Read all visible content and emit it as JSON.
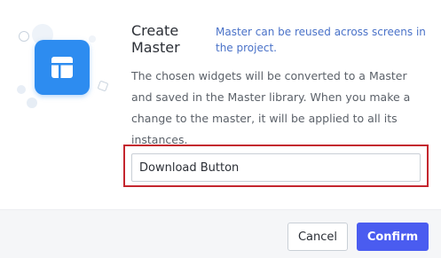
{
  "dialog": {
    "title": "Create Master",
    "note": "Master can be reused across screens in the project.",
    "description": "The chosen widgets will be converted to a Master and saved in the Master library. When you make a change to the master, it will be applied to all its instances.",
    "name_input": {
      "value": "Download Button"
    },
    "icon": "master-template-icon",
    "colors": {
      "accent": "#2d8cf0",
      "confirm": "#4a5cf0",
      "highlight": "#c4262e",
      "note": "#4a72c8"
    }
  },
  "footer": {
    "cancel_label": "Cancel",
    "confirm_label": "Confirm"
  }
}
